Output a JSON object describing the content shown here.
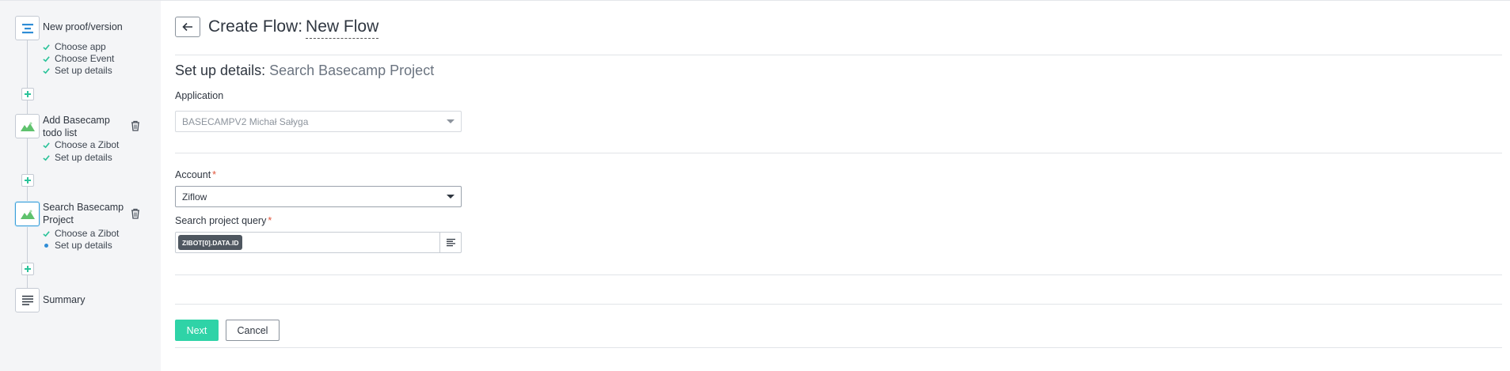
{
  "sidebar": {
    "steps": [
      {
        "title": "New proof/version",
        "icon": "ziflow-logo-icon",
        "substeps": [
          "Choose app",
          "Choose Event",
          "Set up details"
        ]
      },
      {
        "title": "Add Basecamp todo list",
        "icon": "basecamp-icon",
        "substeps": [
          "Choose a Zibot",
          "Set up details"
        ]
      },
      {
        "title": "Search Basecamp Project",
        "icon": "basecamp-icon",
        "substeps": [
          "Choose a Zibot",
          "Set up details"
        ]
      },
      {
        "title": "Summary",
        "icon": "summary-lines-icon",
        "substeps": []
      }
    ]
  },
  "header": {
    "title_prefix": "Create Flow:",
    "flow_name": "New Flow"
  },
  "section": {
    "title_prefix": "Set up details:",
    "title_subject": "Search Basecamp Project"
  },
  "form": {
    "application_label": "Application",
    "application_value": "BASECAMPV2 Michał Sałyga",
    "account_label": "Account",
    "account_value": "Ziflow",
    "query_label": "Search project query",
    "query_tag": "ZIBOT[0].DATA.ID",
    "required_marker": "*"
  },
  "buttons": {
    "next": "Next",
    "cancel": "Cancel"
  },
  "colors": {
    "accent_green": "#2fd3a7",
    "check_green": "#2cc39a",
    "active_blue": "#2f8dd6",
    "required_red": "#e0543a"
  }
}
